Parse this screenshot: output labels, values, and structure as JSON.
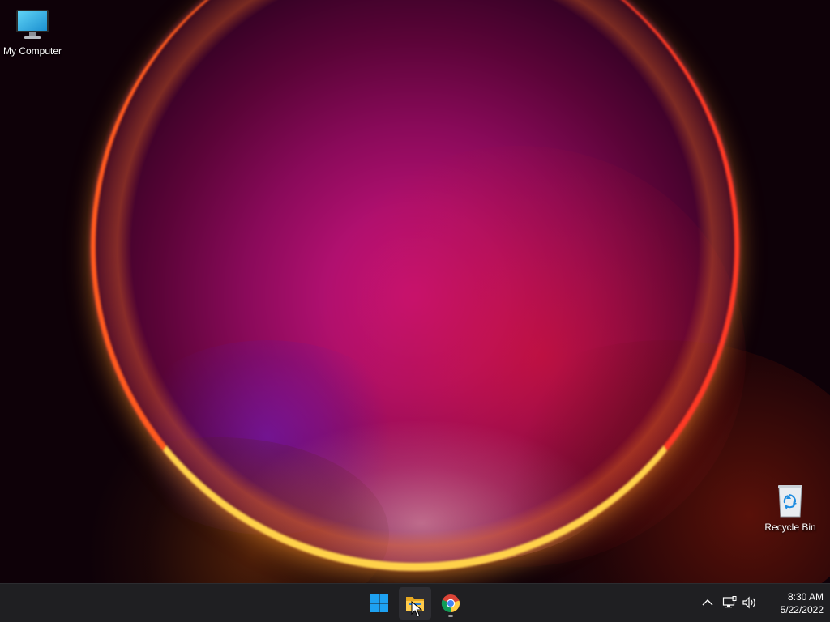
{
  "desktop": {
    "icons": [
      {
        "label": "My Computer",
        "icon": "monitor-icon"
      },
      {
        "label": "Recycle Bin",
        "icon": "recycle-bin-icon"
      }
    ]
  },
  "taskbar": {
    "apps": [
      {
        "name": "Start",
        "icon": "windows-logo-icon"
      },
      {
        "name": "File Explorer",
        "icon": "folder-icon"
      },
      {
        "name": "Google Chrome",
        "icon": "chrome-icon"
      }
    ],
    "tray": {
      "icons": [
        "chevron-up-icon",
        "network-icon",
        "volume-icon"
      ]
    },
    "clock": {
      "time": "8:30 AM",
      "date": "5/22/2022"
    }
  },
  "colors": {
    "taskbar_bg": "#1f1f22",
    "accent_blue": "#0a84d8",
    "wallpaper_magenta": "#c8127e",
    "ring_yellow": "#ffd24a"
  }
}
